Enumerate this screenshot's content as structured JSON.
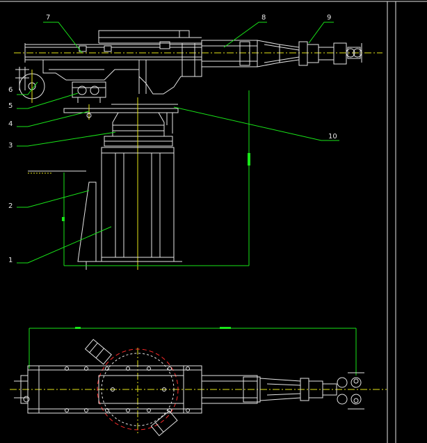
{
  "drawing": {
    "frame_color": "#e6e6e6",
    "leader_color": "#19e619",
    "centerline_color": "#e6e619",
    "callouts": [
      "1",
      "2",
      "3",
      "4",
      "5",
      "6",
      "7",
      "8",
      "9",
      "10"
    ]
  }
}
